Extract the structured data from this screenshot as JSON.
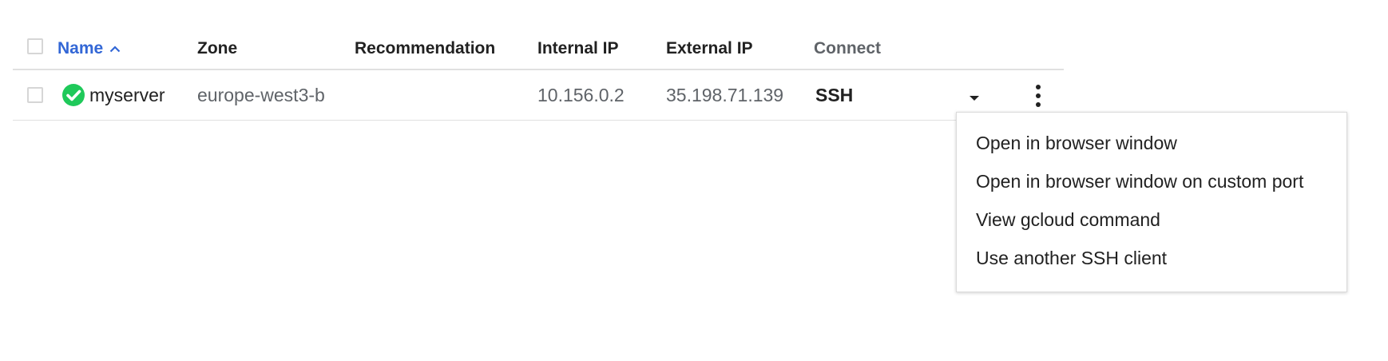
{
  "table": {
    "headers": {
      "name": "Name",
      "zone": "Zone",
      "recommendation": "Recommendation",
      "internal_ip": "Internal IP",
      "external_ip": "External IP",
      "connect": "Connect"
    },
    "sort": {
      "column": "name",
      "direction": "ascending"
    },
    "rows": [
      {
        "status": "running",
        "name": "myserver",
        "zone": "europe-west3-b",
        "recommendation": "",
        "internal_ip": "10.156.0.2",
        "external_ip": "35.198.71.139",
        "connect": "SSH"
      }
    ]
  },
  "connect_menu": {
    "items": [
      "Open in browser window",
      "Open in browser window on custom port",
      "View gcloud command",
      "Use another SSH client"
    ]
  },
  "colors": {
    "accent": "#3367d6",
    "status_ok": "#1fc95a"
  },
  "icons": {
    "sort": "chevron-up-icon",
    "status": "check-circle-icon",
    "dropdown": "caret-down-icon",
    "more": "more-vert-icon"
  }
}
